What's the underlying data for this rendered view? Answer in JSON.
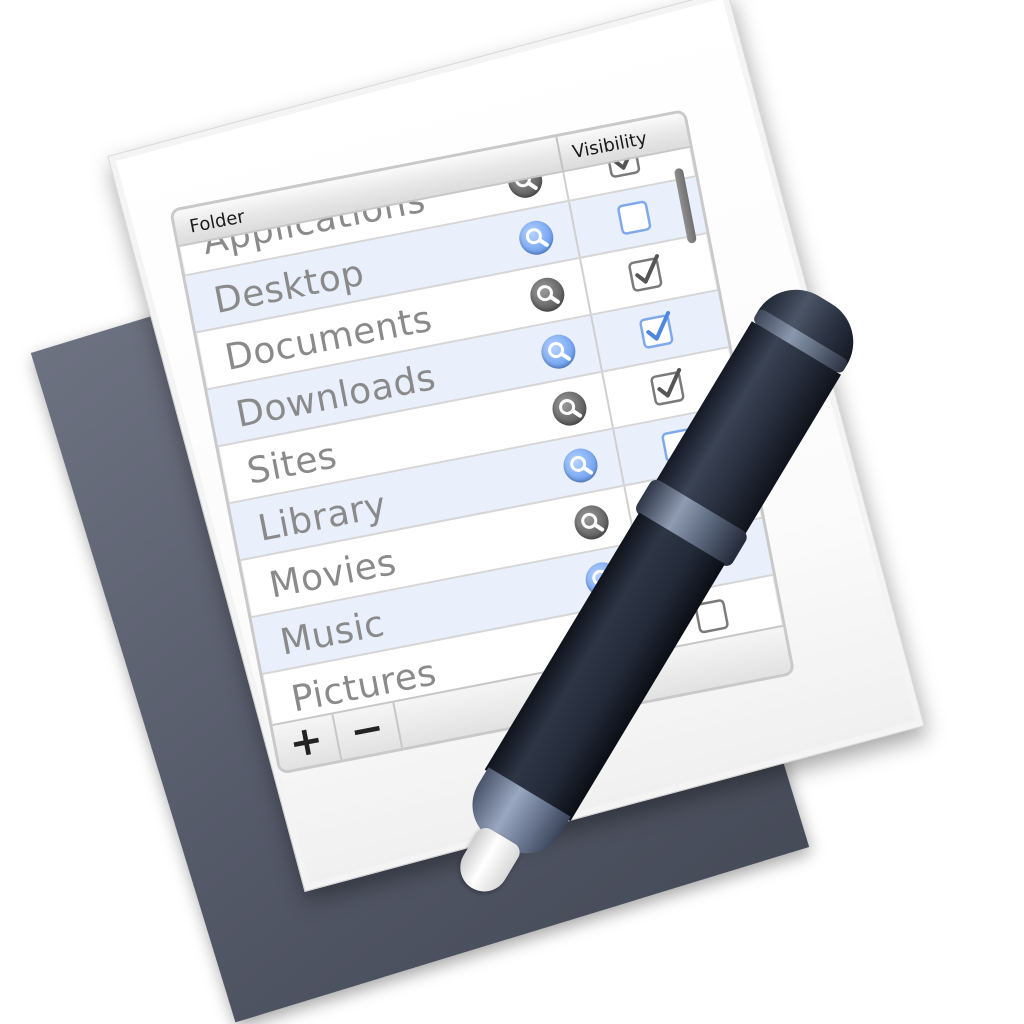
{
  "table": {
    "headers": {
      "folder": "Folder",
      "visibility": "Visibility"
    },
    "rows": [
      {
        "name": "Applications",
        "magnifier": "gray",
        "checked": true,
        "checkbox_style": "gray"
      },
      {
        "name": "Desktop",
        "magnifier": "blue",
        "checked": false,
        "checkbox_style": "blue"
      },
      {
        "name": "Documents",
        "magnifier": "gray",
        "checked": true,
        "checkbox_style": "gray"
      },
      {
        "name": "Downloads",
        "magnifier": "blue",
        "checked": true,
        "checkbox_style": "blue"
      },
      {
        "name": "Sites",
        "magnifier": "gray",
        "checked": true,
        "checkbox_style": "gray"
      },
      {
        "name": "Library",
        "magnifier": "blue",
        "checked": false,
        "checkbox_style": "blue"
      },
      {
        "name": "Movies",
        "magnifier": "gray",
        "checked": true,
        "checkbox_style": "gray"
      },
      {
        "name": "Music",
        "magnifier": "blue",
        "checked": false,
        "checkbox_style": "blue"
      },
      {
        "name": "Pictures",
        "magnifier": "gray",
        "checked": false,
        "checkbox_style": "gray"
      }
    ],
    "footer": {
      "add_label": "+",
      "remove_label": "−"
    }
  },
  "icons": {
    "row_action": "magnifier-icon",
    "visibility": "checkbox-icon",
    "pen": "pen-icon"
  },
  "colors": {
    "alt_row": "#e9effb",
    "accent_blue": "#6ea0ef",
    "gray_icon": "#5d5d5d",
    "back_sheet": "#545968",
    "pen_body": "#232a38"
  }
}
